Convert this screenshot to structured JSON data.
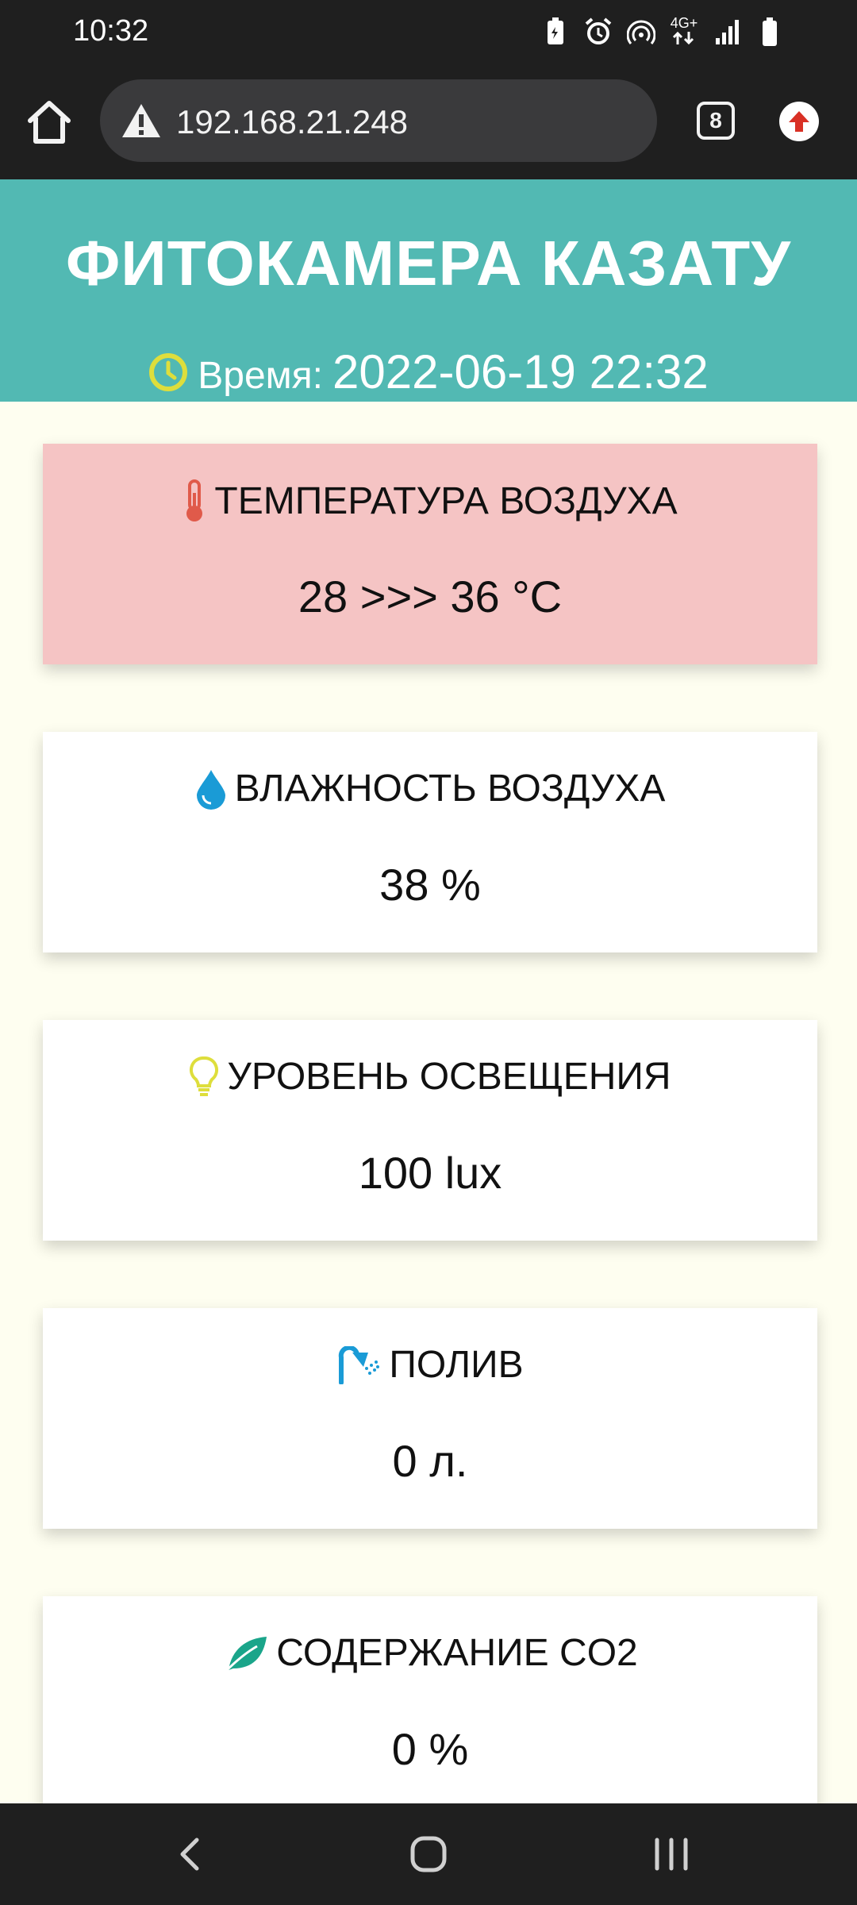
{
  "status_bar": {
    "time": "10:32",
    "network": "4G+",
    "icons": [
      "battery-saver-icon",
      "alarm-icon",
      "hotspot-icon",
      "signal-icon",
      "battery-icon"
    ]
  },
  "browser": {
    "url": "192.168.21.248",
    "tab_count": "8",
    "icons": [
      "home-icon",
      "warning-icon",
      "tabs-icon",
      "update-icon"
    ]
  },
  "header": {
    "title": "ФИТОКАМЕРА КАЗАТУ",
    "time_label": "Время:",
    "time_value": "2022-06-19 22:32"
  },
  "cards": [
    {
      "title": "ТЕМПЕРАТУРА ВОЗДУХА",
      "value": "28 >>> 36 °C",
      "icon": "thermometer-icon",
      "color": "#e05a4a",
      "highlight": "#f5c4c4"
    },
    {
      "title": "ВЛАЖНОСТЬ ВОЗДУХА",
      "value": "38 %",
      "icon": "water-drop-icon",
      "color": "#1a9bd6"
    },
    {
      "title": "УРОВЕНЬ ОСВЕЩЕНИЯ",
      "value": "100 lux",
      "icon": "lightbulb-icon",
      "color": "#dede3c"
    },
    {
      "title": "ПОЛИВ",
      "value": "0 л.",
      "icon": "shower-icon",
      "color": "#1a9bd6"
    },
    {
      "title": "СОДЕРЖАНИЕ CO2",
      "value": "0 %",
      "icon": "leaf-icon",
      "color": "#1aa58a"
    }
  ],
  "colors": {
    "header_bg": "#52b9b3",
    "page_bg": "#fefef0",
    "clock_icon": "#dede3c",
    "update_icon": "#d93025"
  }
}
